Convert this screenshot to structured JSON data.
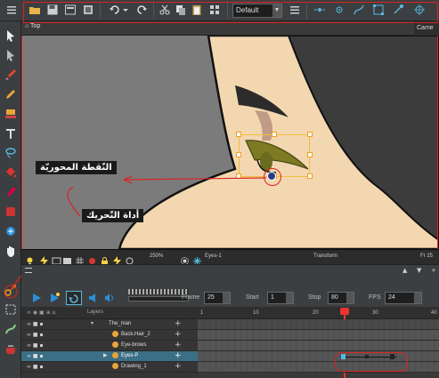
{
  "toolbar": {
    "preset_value": "Default"
  },
  "view": {
    "breadcrumb": "Top",
    "camera_tab": "Came"
  },
  "callouts": {
    "pivot": "النّقطة المحوريّة",
    "transform_tool": "أداة التّحريك"
  },
  "view_status": {
    "zoom": "250%",
    "layer": "Eyes-1",
    "mode": "Transform",
    "frame": "Fr 25"
  },
  "playback": {
    "frame_label": "Frame",
    "frame_value": "25",
    "start_label": "Start",
    "start_value": "1",
    "stop_label": "Stop",
    "stop_value": "80",
    "fps_label": "FPS",
    "fps_value": "24"
  },
  "layers": {
    "header": "Layers",
    "items": [
      {
        "name": "The_man"
      },
      {
        "name": "Back.Hair_2"
      },
      {
        "name": "Eye-brows"
      },
      {
        "name": "Eyes-P"
      },
      {
        "name": "Drawing_1"
      }
    ]
  },
  "ruler": {
    "ticks": [
      "1",
      "10",
      "20",
      "30",
      "40"
    ]
  },
  "colors": {
    "skin": "#f3d7b0",
    "hair": "#3c3c3c",
    "stage_bg": "#7b7b7b",
    "annotation": "#d22222",
    "selection": "#f0a020"
  }
}
